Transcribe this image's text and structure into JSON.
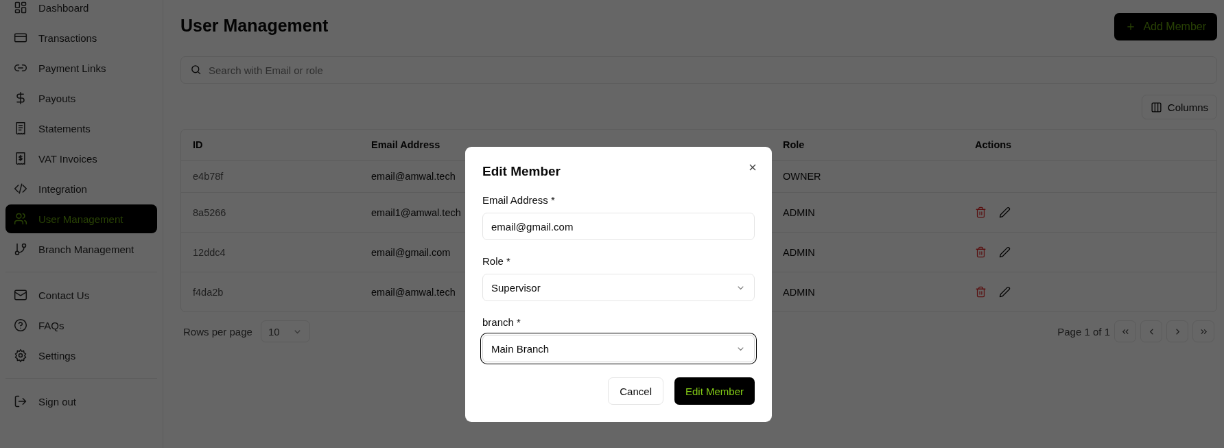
{
  "sidebar": {
    "sections": [
      {
        "items": [
          {
            "label": "Dashboard",
            "selected": false
          },
          {
            "label": "Transactions",
            "selected": false
          },
          {
            "label": "Payment Links",
            "selected": false
          },
          {
            "label": "Payouts",
            "selected": false
          },
          {
            "label": "Statements",
            "selected": false
          },
          {
            "label": "VAT Invoices",
            "selected": false
          },
          {
            "label": "Integration",
            "selected": false
          },
          {
            "label": "User Management",
            "selected": true
          },
          {
            "label": "Branch Management",
            "selected": false
          }
        ]
      },
      {
        "items": [
          {
            "label": "Contact Us",
            "selected": false
          },
          {
            "label": "FAQs",
            "selected": false
          },
          {
            "label": "Settings",
            "selected": false
          }
        ]
      },
      {
        "items": [
          {
            "label": "Sign out",
            "selected": false
          }
        ]
      }
    ]
  },
  "page": {
    "title": "User Management",
    "add_button": "Add Member",
    "search": {
      "placeholder": "Search with Email or role"
    },
    "columns_button": "Columns"
  },
  "table": {
    "columns": [
      "ID",
      "Email Address",
      "Role",
      "Actions"
    ],
    "rows": [
      {
        "id": "e4b78f",
        "email": "email@amwal.tech",
        "role": "OWNER",
        "has_actions": false
      },
      {
        "id": "8a5266",
        "email": "email1@amwal.tech",
        "role": "ADMIN",
        "has_actions": true
      },
      {
        "id": "12ddc4",
        "email": "email@gmail.com",
        "role": "ADMIN",
        "has_actions": true
      },
      {
        "id": "f4da2b",
        "email": "email@amwal.tech",
        "role": "ADMIN",
        "has_actions": true
      }
    ]
  },
  "pagination": {
    "rows_per_page_label": "Rows per page",
    "rows_per_page": "10",
    "page_info": "Page 1 of 1"
  },
  "modal": {
    "title": "Edit Member",
    "fields": [
      {
        "label": "Email Address *",
        "kind": "input",
        "value": "email@gmail.com",
        "focused": false
      },
      {
        "label": "Role *",
        "kind": "select",
        "value": "Supervisor",
        "focused": false
      },
      {
        "label": "branch *",
        "kind": "select",
        "value": "Main Branch",
        "focused": true
      }
    ],
    "cancel_button": "Cancel",
    "submit_button": "Edit Member"
  }
}
